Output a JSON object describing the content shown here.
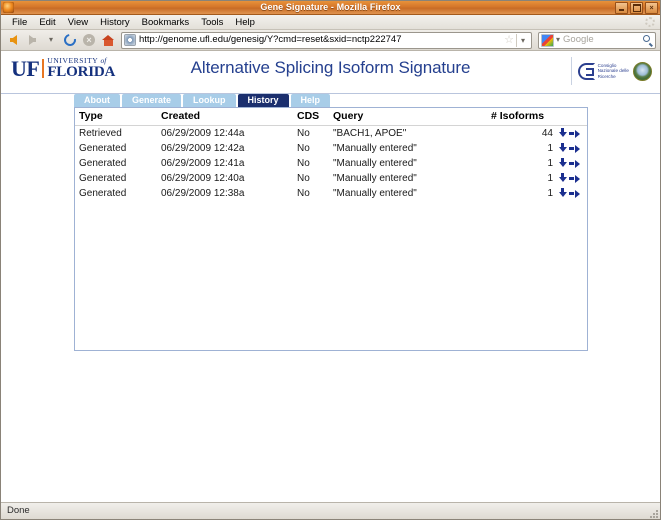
{
  "window": {
    "title": "Gene Signature - Mozilla Firefox",
    "minimize_label": "",
    "maximize_label": "",
    "close_label": "×"
  },
  "menubar": {
    "items": [
      {
        "label": "File",
        "accel": "F"
      },
      {
        "label": "Edit",
        "accel": "E"
      },
      {
        "label": "View",
        "accel": "V"
      },
      {
        "label": "History",
        "accel": "s"
      },
      {
        "label": "Bookmarks",
        "accel": "B"
      },
      {
        "label": "Tools",
        "accel": "T"
      },
      {
        "label": "Help",
        "accel": "H"
      }
    ]
  },
  "toolbar": {
    "back_title": "Back",
    "forward_title": "Forward",
    "dropdown_title": "Recent pages",
    "reload_title": "Reload",
    "stop_title": "Stop",
    "stop_glyph": "×",
    "home_title": "Home",
    "url": "http://genome.ufl.edu/genesig/Y?cmd=reset&sxid=nctp222747",
    "bookmark_star": "☆",
    "url_dropdown": "⌄",
    "search_dropdown": "⌄",
    "search_placeholder": "Google",
    "search_value": ""
  },
  "page": {
    "title": "Alternative Splicing Isoform Signature",
    "uf_logo": {
      "mark": "UF",
      "line1_a": "UNIVERSITY ",
      "line1_b": "of",
      "line2": "FLORIDA"
    },
    "cnr_logo": {
      "line1": "Consiglio",
      "line2": "Nazionale delle",
      "line3": "Ricerche"
    },
    "tabs": [
      {
        "label": "About",
        "active": false
      },
      {
        "label": "Generate",
        "active": false
      },
      {
        "label": "Lookup",
        "active": false
      },
      {
        "label": "History",
        "active": true
      },
      {
        "label": "Help",
        "active": false
      }
    ],
    "table": {
      "headers": [
        "Type",
        "Created",
        "CDS",
        "Query",
        "# Isoforms",
        ""
      ],
      "rows": [
        {
          "type": "Retrieved",
          "created": "06/29/2009 12:44a",
          "cds": "No",
          "query": "\"BACH1, APOE\"",
          "isoforms": "44",
          "download_icon": "arrow-down-icon",
          "open_icon": "arrow-right-icon"
        },
        {
          "type": "Generated",
          "created": "06/29/2009 12:42a",
          "cds": "No",
          "query": "\"Manually entered\"",
          "isoforms": "1",
          "download_icon": "arrow-down-icon",
          "open_icon": "arrow-right-icon"
        },
        {
          "type": "Generated",
          "created": "06/29/2009 12:41a",
          "cds": "No",
          "query": "\"Manually entered\"",
          "isoforms": "1",
          "download_icon": "arrow-down-icon",
          "open_icon": "arrow-right-icon"
        },
        {
          "type": "Generated",
          "created": "06/29/2009 12:40a",
          "cds": "No",
          "query": "\"Manually entered\"",
          "isoforms": "1",
          "download_icon": "arrow-down-icon",
          "open_icon": "arrow-right-icon"
        },
        {
          "type": "Generated",
          "created": "06/29/2009 12:38a",
          "cds": "No",
          "query": "\"Manually entered\"",
          "isoforms": "1",
          "download_icon": "arrow-down-icon",
          "open_icon": "arrow-right-icon"
        }
      ]
    }
  },
  "statusbar": {
    "text": "Done"
  },
  "colors": {
    "titlebar_orange": "#d4762a",
    "uf_navy": "#15317e",
    "uf_orange": "#e87722",
    "tab_inactive": "#a8cde8",
    "tab_active": "#1b2f6e",
    "page_title": "#25408f",
    "arrow_blue": "#1b2f8f",
    "panel_border": "#9fb2d4"
  }
}
